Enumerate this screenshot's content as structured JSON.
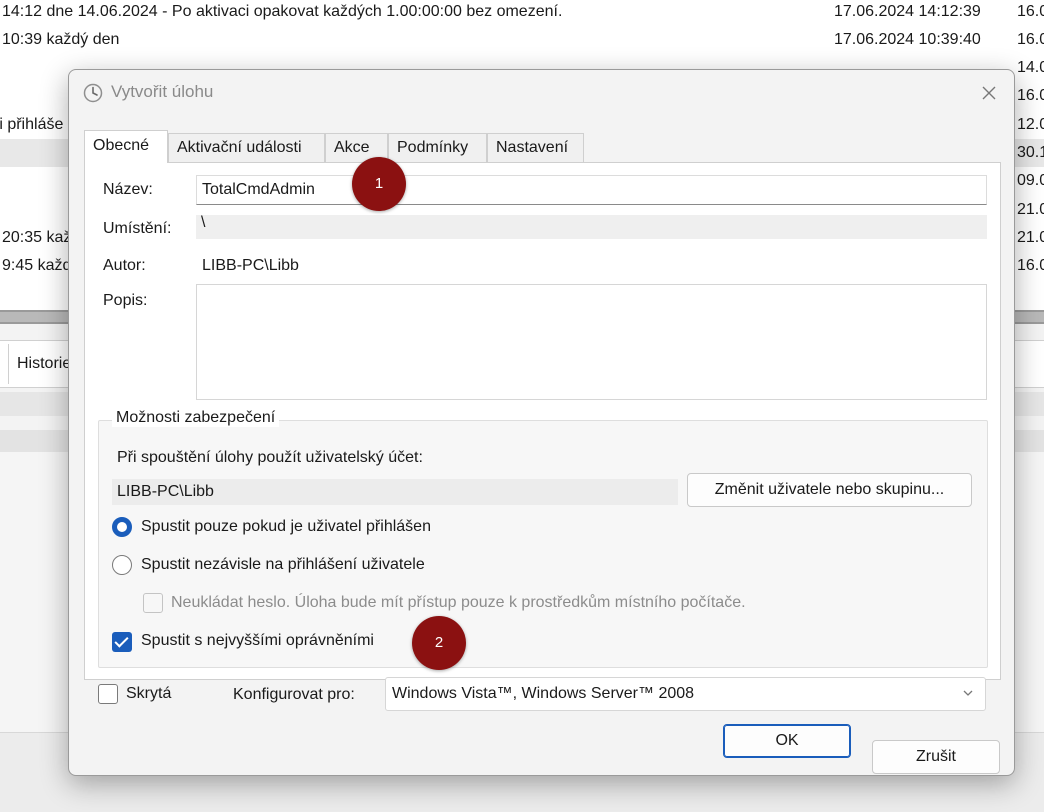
{
  "background": {
    "rows": [
      {
        "trigger": "14:12 dne 14.06.2024 - Po aktivaci opakovat každých 1.00:00:00 bez omezení.",
        "next_run": "17.06.2024 14:12:39",
        "last_run": "16.0"
      },
      {
        "trigger": "10:39 každý den",
        "next_run": "17.06.2024 10:39:40",
        "last_run": "16.0"
      },
      {
        "trigger": "",
        "next_run": "",
        "last_run": "14.0"
      },
      {
        "trigger": "",
        "next_run": "",
        "last_run": "16.0"
      },
      {
        "trigger": "ři přihláše",
        "next_run": "",
        "last_run": "12.0"
      },
      {
        "trigger": "",
        "next_run": "",
        "last_run": "30.1"
      },
      {
        "trigger": "",
        "next_run": "",
        "last_run": "09.0"
      },
      {
        "trigger": "",
        "next_run": "",
        "last_run": "21.0"
      },
      {
        "trigger": "20:35 kaž",
        "next_run": "",
        "last_run": "21.0"
      },
      {
        "trigger": "9:45 každ",
        "next_run": "",
        "last_run": "16.0"
      }
    ],
    "history_tab": "Historie"
  },
  "dialog": {
    "title": "Vytvořit úlohu",
    "tabs": [
      "Obecné",
      "Aktivační události",
      "Akce",
      "Podmínky",
      "Nastavení"
    ],
    "name_label": "Název:",
    "name_value": "TotalCmdAdmin",
    "location_label": "Umístění:",
    "location_value": "\\",
    "author_label": "Autor:",
    "author_value": "LIBB-PC\\Libb",
    "description_label": "Popis:",
    "description_value": "",
    "security": {
      "title": "Možnosti zabezpečení",
      "account_label": "Při spouštění úlohy použít uživatelský účet:",
      "account_value": "LIBB-PC\\Libb",
      "change_button": "Změnit uživatele nebo skupinu...",
      "radio_logged_on": "Spustit pouze pokud je uživatel přihlášen",
      "radio_independent": "Spustit nezávisle na přihlášení uživatele",
      "no_store_password": "Neukládat heslo.  Úloha bude mít přístup pouze k prostředkům místního počítače.",
      "highest_privileges": "Spustit s nejvyššími oprávněními"
    },
    "hidden_label": "Skrytá",
    "configure_label": "Konfigurovat pro:",
    "configure_value": "Windows Vista™, Windows Server™ 2008",
    "ok_button": "OK",
    "cancel_button": "Zrušit"
  },
  "annotations": [
    "1",
    "2"
  ],
  "colors": {
    "accent": "#1a5dbb",
    "badge": "#8b1111"
  }
}
